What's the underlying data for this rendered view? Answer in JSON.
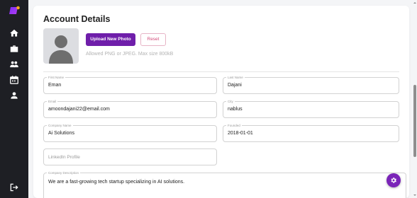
{
  "colors": {
    "sidebar_bg": "#1e1f24",
    "accent": "#6f1eaa",
    "reset_text": "#d24b7a",
    "logo_gradient": [
      "#7b2ff7",
      "#f7a91e"
    ]
  },
  "sidebar": {
    "logo": "brand-logo",
    "items": [
      {
        "icon": "home-icon"
      },
      {
        "icon": "briefcase-icon"
      },
      {
        "icon": "group-icon"
      },
      {
        "icon": "calendar-icon"
      },
      {
        "icon": "person-icon"
      }
    ],
    "logout_icon": "logout-icon"
  },
  "main": {
    "title": "Account Details",
    "photo": {
      "upload_label": "Upload New Photo",
      "reset_label": "Reset",
      "hint": "Allowed PNG or JPEG. Max size 800kB"
    },
    "fields": {
      "first_name": {
        "label": "First Name",
        "value": "Eman"
      },
      "last_name": {
        "label": "Last Name",
        "value": "Dajani"
      },
      "email": {
        "label": "Email",
        "value": "amoondajani22@email.com"
      },
      "city": {
        "label": "City",
        "value": "nablus"
      },
      "company_name": {
        "label": "Company Name",
        "value": "Ai Solutions"
      },
      "founded": {
        "label": "Founded",
        "value": "2018-01-01"
      },
      "linkedin": {
        "placeholder": "LinkedIn Profile"
      },
      "company_description": {
        "label": "Company Description",
        "value": "We are a fast-growing tech startup specializing in AI solutions."
      }
    }
  },
  "fab_icon": "settings-gear-icon"
}
